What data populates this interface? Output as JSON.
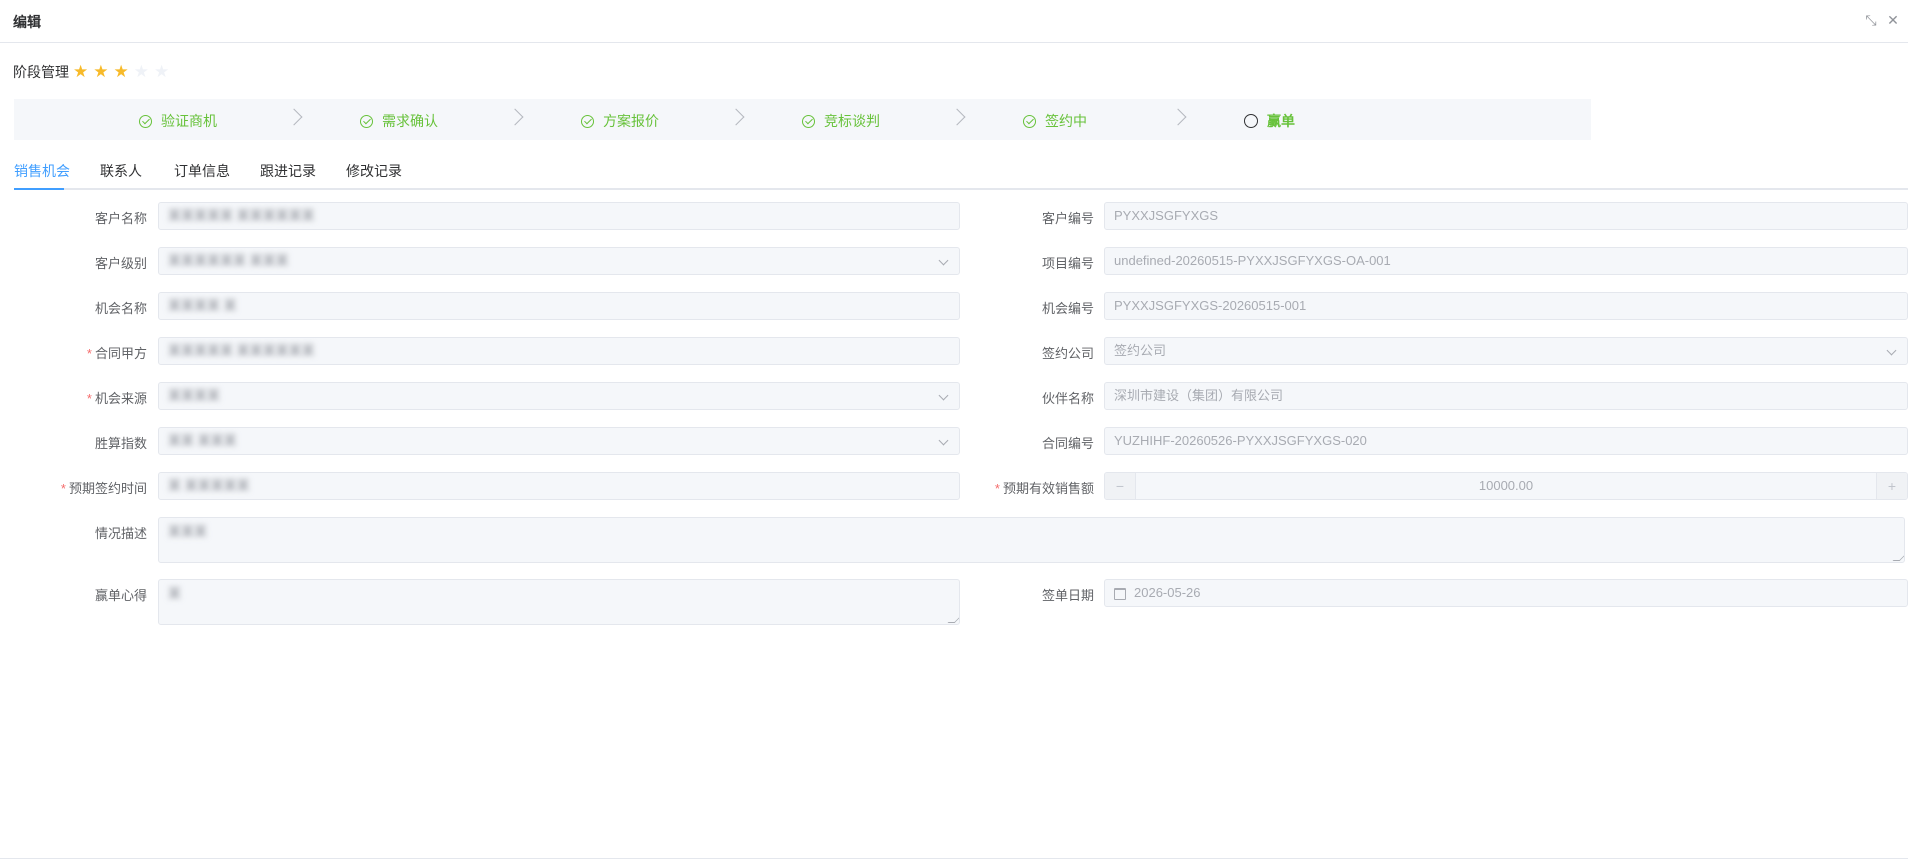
{
  "window": {
    "title": "编辑",
    "minimize_icon": "shrink-icon",
    "close_icon": "close-icon"
  },
  "stage": {
    "label": "阶段管理",
    "rating": 3,
    "max": 5
  },
  "steps": [
    {
      "label": "验证商机",
      "status": "done"
    },
    {
      "label": "需求确认",
      "status": "done"
    },
    {
      "label": "方案报价",
      "status": "done"
    },
    {
      "label": "竞标谈判",
      "status": "done"
    },
    {
      "label": "签约中",
      "status": "done"
    },
    {
      "label": "赢单",
      "status": "current"
    }
  ],
  "tabs": [
    "销售机会",
    "联系人",
    "订单信息",
    "跟进记录",
    "修改记录"
  ],
  "active_tab": 0,
  "form": {
    "left": [
      {
        "label": "客户名称",
        "required": false,
        "value": "某某某某某 某某某某某某"
      },
      {
        "label": "客户级别",
        "required": false,
        "value": "某某某某某某 某某某",
        "select": true
      },
      {
        "label": "机会名称",
        "required": false,
        "value": "某某某某 某"
      },
      {
        "label": "合同甲方",
        "required": true,
        "value": "某某某某某 某某某某某某"
      },
      {
        "label": "机会来源",
        "required": true,
        "value": "某某某某",
        "select": true
      },
      {
        "label": "胜算指数",
        "required": false,
        "value": "某某 某某某",
        "select": true
      },
      {
        "label": "预期签约时间",
        "required": true,
        "value": "某 某某某某某"
      },
      {
        "label": "情况描述",
        "required": false,
        "value": "某某某",
        "textarea": true
      },
      {
        "label": "赢单心得",
        "required": false,
        "value": "某",
        "textarea": true
      }
    ],
    "right": [
      {
        "label": "客户编号",
        "required": false,
        "value": "PYXXJSGFYXGS"
      },
      {
        "label": "项目编号",
        "required": false,
        "value": "undefined-20260515-PYXXJSGFYXGS-OA-001"
      },
      {
        "label": "机会编号",
        "required": false,
        "value": "PYXXJSGFYXGS-20260515-001"
      },
      {
        "label": "签约公司",
        "required": false,
        "value": "签约公司",
        "select": true
      },
      {
        "label": "伙伴名称",
        "required": false,
        "value": "深圳市建设（集团）有限公司"
      },
      {
        "label": "合同编号",
        "required": false,
        "value": "YUZHIHF-20260526-PYXXJSGFYXGS-020"
      },
      {
        "label": "预期有效销售额",
        "required": true,
        "value": "10000.00",
        "number": true,
        "dec": "−",
        "inc": "+"
      },
      {
        "label": "签单日期",
        "required": false,
        "value": "2026-05-26",
        "date": true
      }
    ]
  },
  "colors": {
    "accent": "#409eff",
    "success": "#67c23a",
    "star": "#f7ba2a",
    "required": "#f56c6c"
  }
}
